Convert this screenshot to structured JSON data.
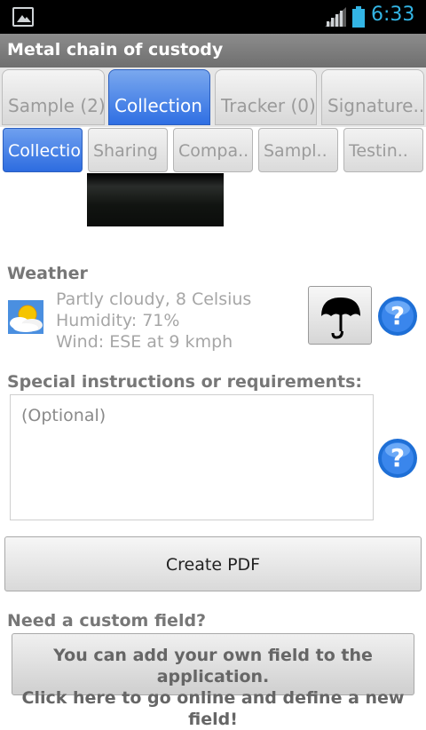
{
  "status_bar": {
    "time": "6:33",
    "time_color": "#33b5e5",
    "icons": [
      "picture-icon",
      "signal-icon",
      "battery-icon"
    ]
  },
  "title_bar": {
    "title": "Metal chain of custody"
  },
  "tabs_primary": [
    {
      "label": "Sample (2)",
      "active": false
    },
    {
      "label": "Collection",
      "active": true
    },
    {
      "label": "Tracker (0)",
      "active": false
    },
    {
      "label": "Signature..",
      "active": false
    }
  ],
  "tabs_secondary": [
    {
      "label": "Collection",
      "active": true
    },
    {
      "label": "Sharing",
      "active": false
    },
    {
      "label": "Compa..",
      "active": false
    },
    {
      "label": "Sampl..",
      "active": false
    },
    {
      "label": "Testin..",
      "active": false
    }
  ],
  "weather": {
    "heading": "Weather",
    "line1": "Partly cloudy, 8 Celsius",
    "line2": "Humidity: 71%",
    "line3": "Wind: ESE at 9 kmph",
    "icon": "partly-cloudy-icon",
    "button_icon": "umbrella-icon"
  },
  "instructions": {
    "heading": "Special instructions or requirements:",
    "placeholder": "(Optional)"
  },
  "create_pdf": {
    "label": "Create PDF"
  },
  "custom_field": {
    "heading": "Need a custom field?",
    "line1": "You can add your own field to the application.",
    "line2": "Click here to go online and define a new field!"
  },
  "colors": {
    "accent_blue": "#2f6fe3",
    "title_bar": "#7d7d7d",
    "help_blue": "#1e6fd6"
  }
}
